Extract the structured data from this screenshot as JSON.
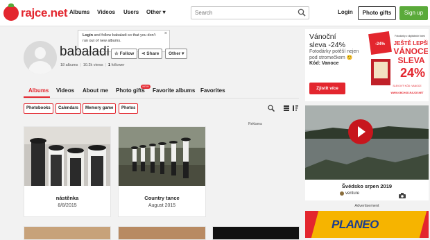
{
  "header": {
    "logo": "rajce.net",
    "nav": [
      "Albums",
      "Videos",
      "Users",
      "Other"
    ],
    "search_placeholder": "Search",
    "login": "Login",
    "photo_gifts": "Photo gifts",
    "signup": "Sign up"
  },
  "tooltip": {
    "bold": "Login",
    "text": "and follow babaladi so that you don't run out of new albums."
  },
  "profile": {
    "username": "babaladi",
    "albums": "18 albums",
    "views": "10.2k views",
    "followers_count": "1",
    "followers_label": "follower",
    "follow": "Follow",
    "share": "Share",
    "other": "Other"
  },
  "tabs": [
    "Albums",
    "Videos",
    "About me",
    "Photo gifts",
    "Favorite albums",
    "Favorites"
  ],
  "tab_badge": "NEW",
  "filters": [
    "Photobooks",
    "Calendars",
    "Memory game",
    "Photos"
  ],
  "reklama": "Reklama",
  "albums": [
    {
      "title": "nástěnka",
      "date": "8/8/2015"
    },
    {
      "title": "Country tance",
      "date": "August 2015"
    }
  ],
  "promo": {
    "title_line1": "Vánoční",
    "title_line2": "sleva -24%",
    "sub_line1": "Fotodárky potěší nejen",
    "sub_line2": "pod stromečkem 😊",
    "code": "Kód: Vanoce",
    "button": "Zjistit více",
    "art_badge": "-24%",
    "art_line1": "JEŠTĚ LEPŠÍ",
    "art_line2": "VÁNOCE",
    "art_line3": "SLEVA",
    "art_pct": "24%",
    "art_small": "Fotodárky z digitálních fotek",
    "art_code": "SLEVOVÝ KÓD: VANOCE",
    "art_url": "WWW.OBCHOD.RAJCE.NET"
  },
  "video": {
    "title": "Švédsko srpen 2019",
    "author": "venture"
  },
  "advert_label": "Advertisement",
  "planeo": "PLANEO",
  "colors": {
    "accent": "#e3262e",
    "signup": "#5aaa3a",
    "planeo": "#f6b400"
  }
}
